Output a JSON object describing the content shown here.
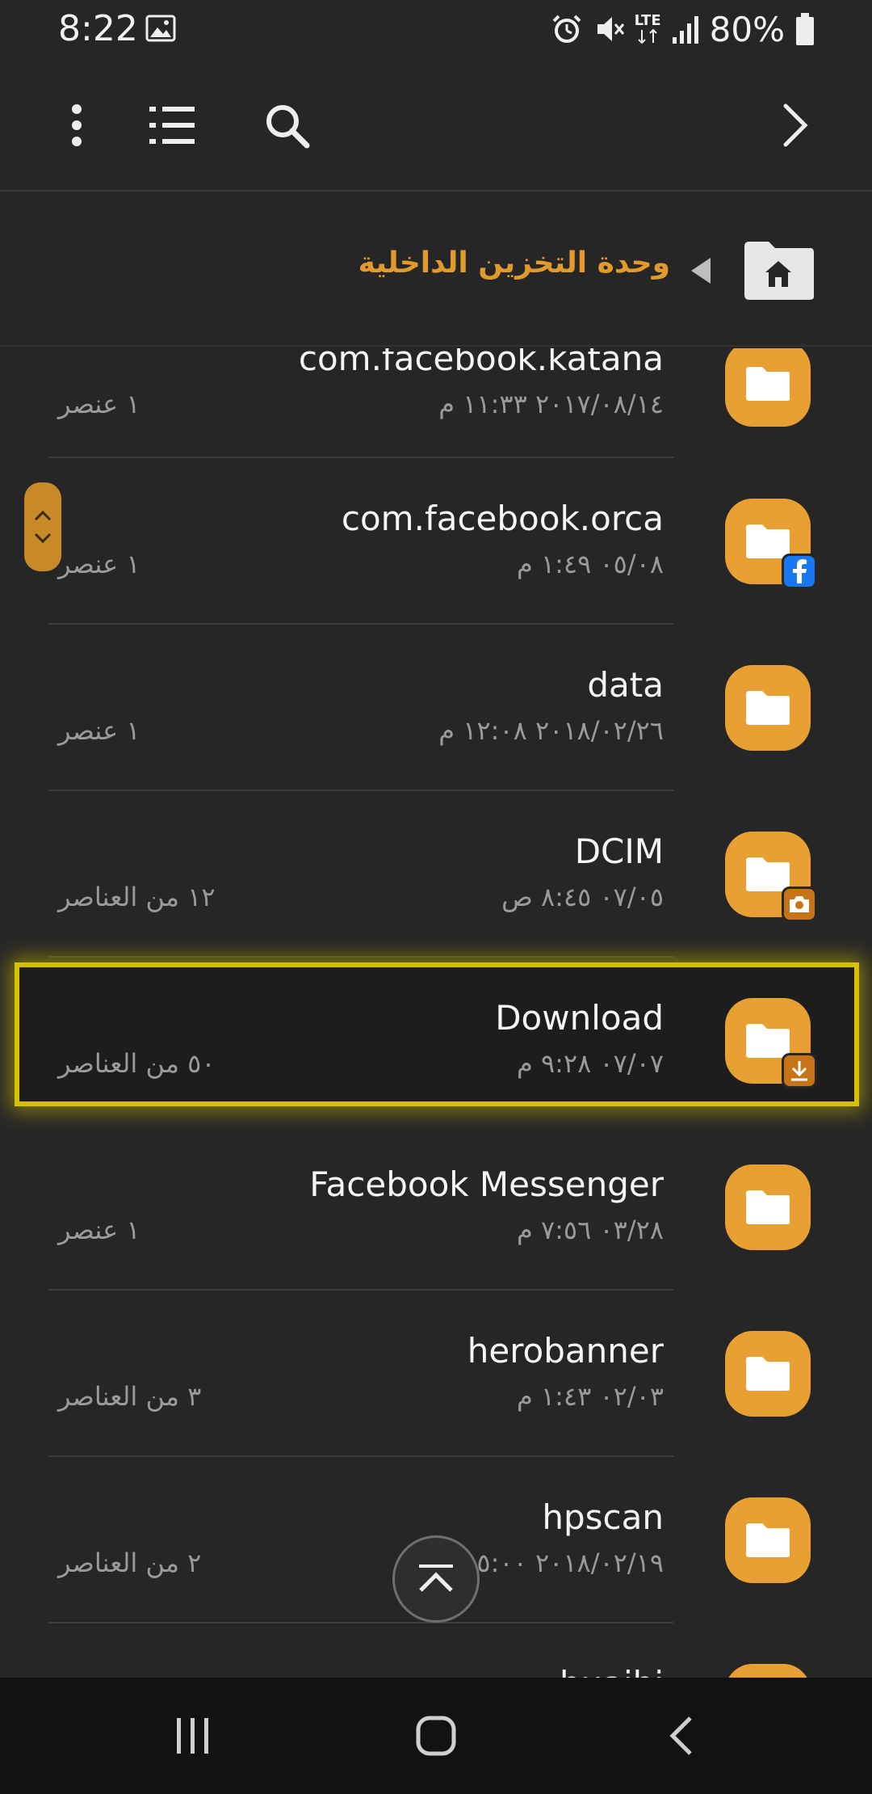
{
  "status_bar": {
    "time": "8:22",
    "battery_text": "80%",
    "network_label": "LTE",
    "icons": [
      "gallery-icon",
      "alarm-icon",
      "mute-icon",
      "lte-icon",
      "signal-icon",
      "battery-icon"
    ]
  },
  "toolbar": {
    "icons": [
      "more-vert-icon",
      "list-view-icon",
      "search-icon",
      "chevron-right-icon"
    ]
  },
  "breadcrumb": {
    "label": "وحدة التخزين الداخلية",
    "home_icon": "home-folder-icon"
  },
  "files": [
    {
      "name": "com.facebook.katana",
      "date": "٢٠١٧/٠٨/١٤ ١١:٣٣ م",
      "count": "١ عنصر",
      "badge": null
    },
    {
      "name": "com.facebook.orca",
      "date": "٠٥/٠٨ ١:٤٩ م",
      "count": "١ عنصر",
      "badge": "facebook"
    },
    {
      "name": "data",
      "date": "٢٠١٨/٠٢/٢٦ ١٢:٠٨ م",
      "count": "١ عنصر",
      "badge": null
    },
    {
      "name": "DCIM",
      "date": "٠٧/٠٥ ٨:٤٥ ص",
      "count": "١٢ من العناصر",
      "badge": "camera"
    },
    {
      "name": "Download",
      "date": "٠٧/٠٧ ٩:٢٨ م",
      "count": "٥٠ من العناصر",
      "badge": "download",
      "selected": true
    },
    {
      "name": "Facebook Messenger",
      "date": "٠٣/٢٨ ٧:٥٦ م",
      "count": "١ عنصر",
      "badge": null
    },
    {
      "name": "herobanner",
      "date": "٠٢/٠٣ ١:٤٣ م",
      "count": "٣ من العناصر",
      "badge": null
    },
    {
      "name": "hpscan",
      "date": "٢٠١٨/٠٢/١٩ ٥:٠٠ م",
      "count": "٢ من العناصر",
      "badge": null
    },
    {
      "name": "huaibi",
      "date": "",
      "count": "",
      "badge": null
    }
  ],
  "colors": {
    "accent": "#e9a032",
    "breadcrumb": "#e29a2c",
    "selection": "#d6c000",
    "background": "#262626"
  },
  "navbar": {
    "icons": [
      "recent-apps-icon",
      "home-icon",
      "back-icon"
    ]
  }
}
